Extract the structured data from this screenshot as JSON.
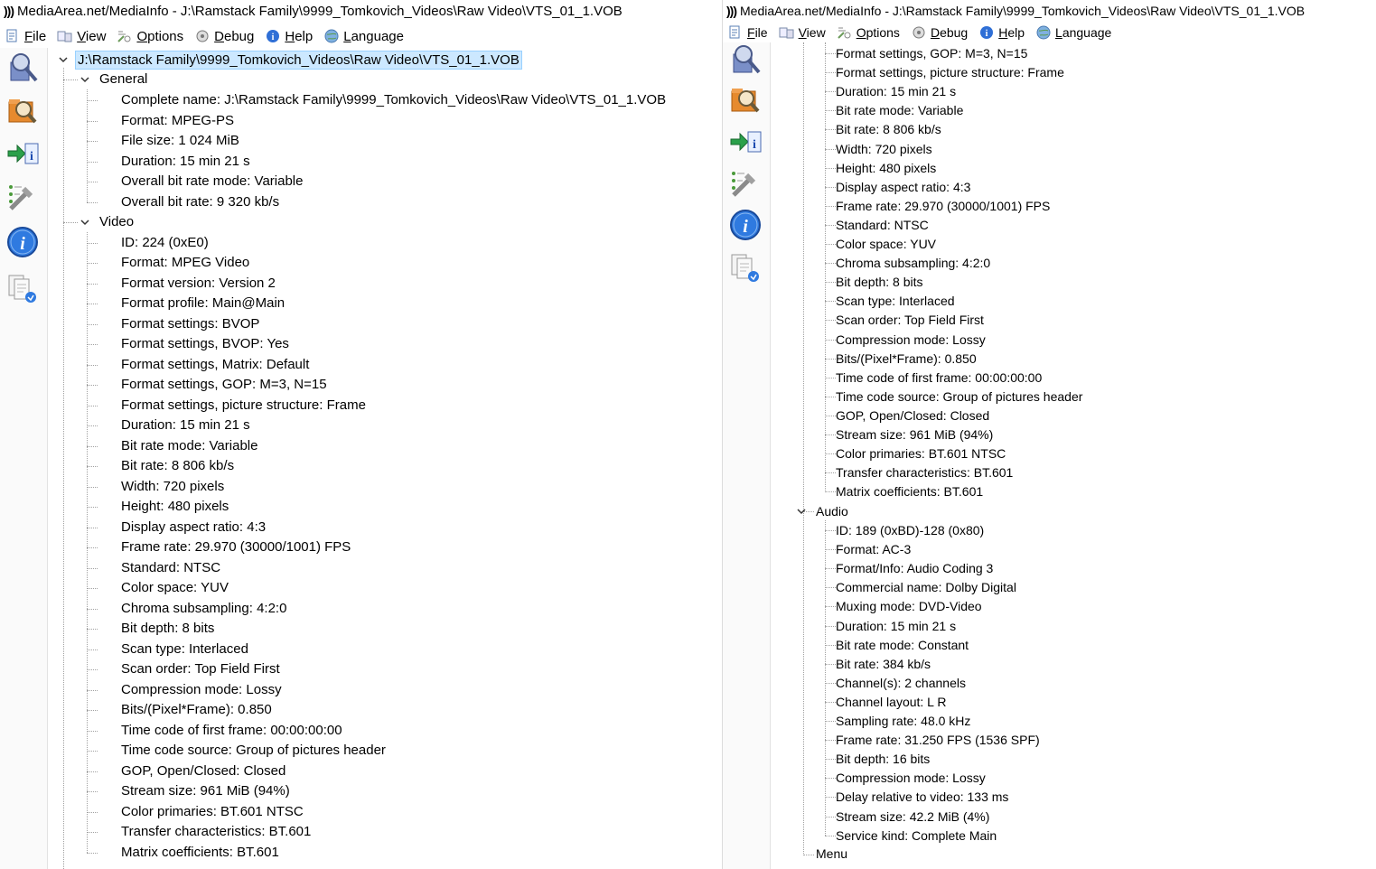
{
  "left": {
    "title": "MediaArea.net/MediaInfo - J:\\Ramstack Family\\9999_Tomkovich_Videos\\Raw Video\\VTS_01_1.VOB",
    "menu": [
      {
        "label": "File",
        "icon": "file-icon"
      },
      {
        "label": "View",
        "icon": "view-icon"
      },
      {
        "label": "Options",
        "icon": "options-icon"
      },
      {
        "label": "Debug",
        "icon": "debug-icon"
      },
      {
        "label": "Help",
        "icon": "help-icon"
      },
      {
        "label": "Language",
        "icon": "language-icon"
      }
    ],
    "root": "J:\\Ramstack Family\\9999_Tomkovich_Videos\\Raw Video\\VTS_01_1.VOB",
    "general_label": "General",
    "general": [
      "Complete name: J:\\Ramstack Family\\9999_Tomkovich_Videos\\Raw Video\\VTS_01_1.VOB",
      "Format: MPEG-PS",
      "File size: 1 024 MiB",
      "Duration: 15 min 21 s",
      "Overall bit rate mode: Variable",
      "Overall bit rate: 9 320 kb/s"
    ],
    "video_label": "Video",
    "video": [
      "ID: 224 (0xE0)",
      "Format: MPEG Video",
      "Format version: Version 2",
      "Format profile: Main@Main",
      "Format settings: BVOP",
      "Format settings, BVOP: Yes",
      "Format settings, Matrix: Default",
      "Format settings, GOP: M=3, N=15",
      "Format settings, picture structure: Frame",
      "Duration: 15 min 21 s",
      "Bit rate mode: Variable",
      "Bit rate: 8 806 kb/s",
      "Width: 720 pixels",
      "Height: 480 pixels",
      "Display aspect ratio: 4:3",
      "Frame rate: 29.970 (30000/1001) FPS",
      "Standard: NTSC",
      "Color space: YUV",
      "Chroma subsampling: 4:2:0",
      "Bit depth: 8 bits",
      "Scan type: Interlaced",
      "Scan order: Top Field First",
      "Compression mode: Lossy",
      "Bits/(Pixel*Frame): 0.850",
      "Time code of first frame: 00:00:00:00",
      "Time code source: Group of pictures header",
      "GOP, Open/Closed: Closed",
      "Stream size: 961 MiB (94%)",
      "Color primaries: BT.601 NTSC",
      "Transfer characteristics: BT.601",
      "Matrix coefficients: BT.601"
    ]
  },
  "right": {
    "title": "MediaArea.net/MediaInfo - J:\\Ramstack Family\\9999_Tomkovich_Videos\\Raw Video\\VTS_01_1.VOB",
    "menu": [
      {
        "label": "File",
        "icon": "file-icon"
      },
      {
        "label": "View",
        "icon": "view-icon"
      },
      {
        "label": "Options",
        "icon": "options-icon"
      },
      {
        "label": "Debug",
        "icon": "debug-icon"
      },
      {
        "label": "Help",
        "icon": "help-icon"
      },
      {
        "label": "Language",
        "icon": "language-icon"
      }
    ],
    "video_tail": [
      "Format settings, GOP: M=3, N=15",
      "Format settings, picture structure: Frame",
      "Duration: 15 min 21 s",
      "Bit rate mode: Variable",
      "Bit rate: 8 806 kb/s",
      "Width: 720 pixels",
      "Height: 480 pixels",
      "Display aspect ratio: 4:3",
      "Frame rate: 29.970 (30000/1001) FPS",
      "Standard: NTSC",
      "Color space: YUV",
      "Chroma subsampling: 4:2:0",
      "Bit depth: 8 bits",
      "Scan type: Interlaced",
      "Scan order: Top Field First",
      "Compression mode: Lossy",
      "Bits/(Pixel*Frame): 0.850",
      "Time code of first frame: 00:00:00:00",
      "Time code source: Group of pictures header",
      "GOP, Open/Closed: Closed",
      "Stream size: 961 MiB (94%)",
      "Color primaries: BT.601 NTSC",
      "Transfer characteristics: BT.601",
      "Matrix coefficients: BT.601"
    ],
    "audio_label": "Audio",
    "audio": [
      "ID: 189 (0xBD)-128 (0x80)",
      "Format: AC-3",
      "Format/Info: Audio Coding 3",
      "Commercial name: Dolby Digital",
      "Muxing mode: DVD-Video",
      "Duration: 15 min 21 s",
      "Bit rate mode: Constant",
      "Bit rate: 384 kb/s",
      "Channel(s): 2 channels",
      "Channel layout: L R",
      "Sampling rate: 48.0 kHz",
      "Frame rate: 31.250 FPS (1536 SPF)",
      "Bit depth: 16 bits",
      "Compression mode: Lossy",
      "Delay relative to video: 133 ms",
      "Stream size: 42.2 MiB (4%)",
      "Service kind: Complete Main"
    ],
    "menu_label": "Menu"
  },
  "toolbar_icons": [
    "open-file-icon",
    "open-folder-icon",
    "export-icon",
    "preferences-icon",
    "about-icon",
    "donate-icon"
  ],
  "colors": {
    "selection_bg": "#cce8ff",
    "selection_border": "#99d1ff",
    "tree_lines": "#a0a0a0"
  }
}
